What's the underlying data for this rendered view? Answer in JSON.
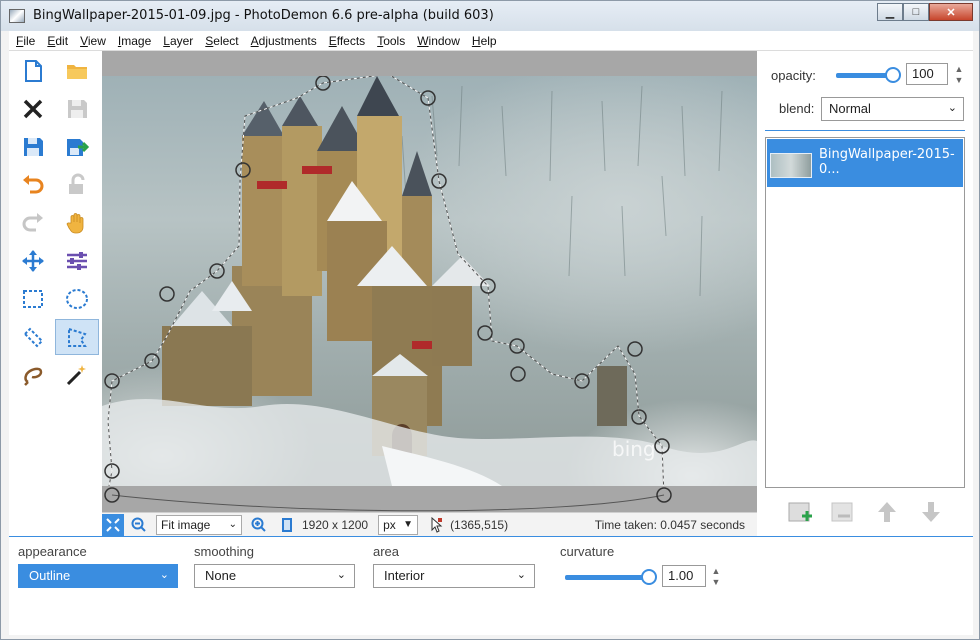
{
  "window": {
    "title": "BingWallpaper-2015-01-09.jpg  -  PhotoDemon 6.6 pre-alpha (build 603)",
    "controls": {
      "minimize": "▁",
      "maximize": "□",
      "close": "✕"
    }
  },
  "menu": [
    "File",
    "Edit",
    "View",
    "Image",
    "Layer",
    "Select",
    "Adjustments",
    "Effects",
    "Tools",
    "Window",
    "Help"
  ],
  "tools": [
    {
      "name": "new-image-icon"
    },
    {
      "name": "open-folder-icon"
    },
    {
      "name": "close-x-icon"
    },
    {
      "name": "save-disk-icon"
    },
    {
      "name": "save-as-icon"
    },
    {
      "name": "export-icon"
    },
    {
      "name": "undo-icon"
    },
    {
      "name": "lock-redo-icon"
    },
    {
      "name": "redo-icon"
    },
    {
      "name": "hand-pan-icon"
    },
    {
      "name": "move-arrows-icon"
    },
    {
      "name": "sliders-icon"
    },
    {
      "name": "rect-select-icon"
    },
    {
      "name": "ellipse-select-icon"
    },
    {
      "name": "line-select-icon"
    },
    {
      "name": "polygon-select-icon",
      "active": true
    },
    {
      "name": "lasso-select-icon"
    },
    {
      "name": "magic-wand-icon"
    }
  ],
  "canvas": {
    "watermark": "bing"
  },
  "statusbar": {
    "zoom_mode": "Fit image",
    "image_size": "1920 x 1200",
    "unit": "px",
    "cursor_pos": "(1365,515)",
    "time_taken": "Time taken: 0.0457 seconds"
  },
  "rightpanel": {
    "opacity_label": "opacity:",
    "opacity_value": "100",
    "blend_label": "blend:",
    "blend_value": "Normal",
    "layer_name": "BingWallpaper-2015-0..."
  },
  "options": {
    "appearance_label": "appearance",
    "appearance_value": "Outline",
    "smoothing_label": "smoothing",
    "smoothing_value": "None",
    "area_label": "area",
    "area_value": "Interior",
    "curvature_label": "curvature",
    "curvature_value": "1.00",
    "curvature_level": 1.0
  },
  "colors": {
    "accent": "#3a8de0",
    "panel": "#f3f3f3"
  }
}
